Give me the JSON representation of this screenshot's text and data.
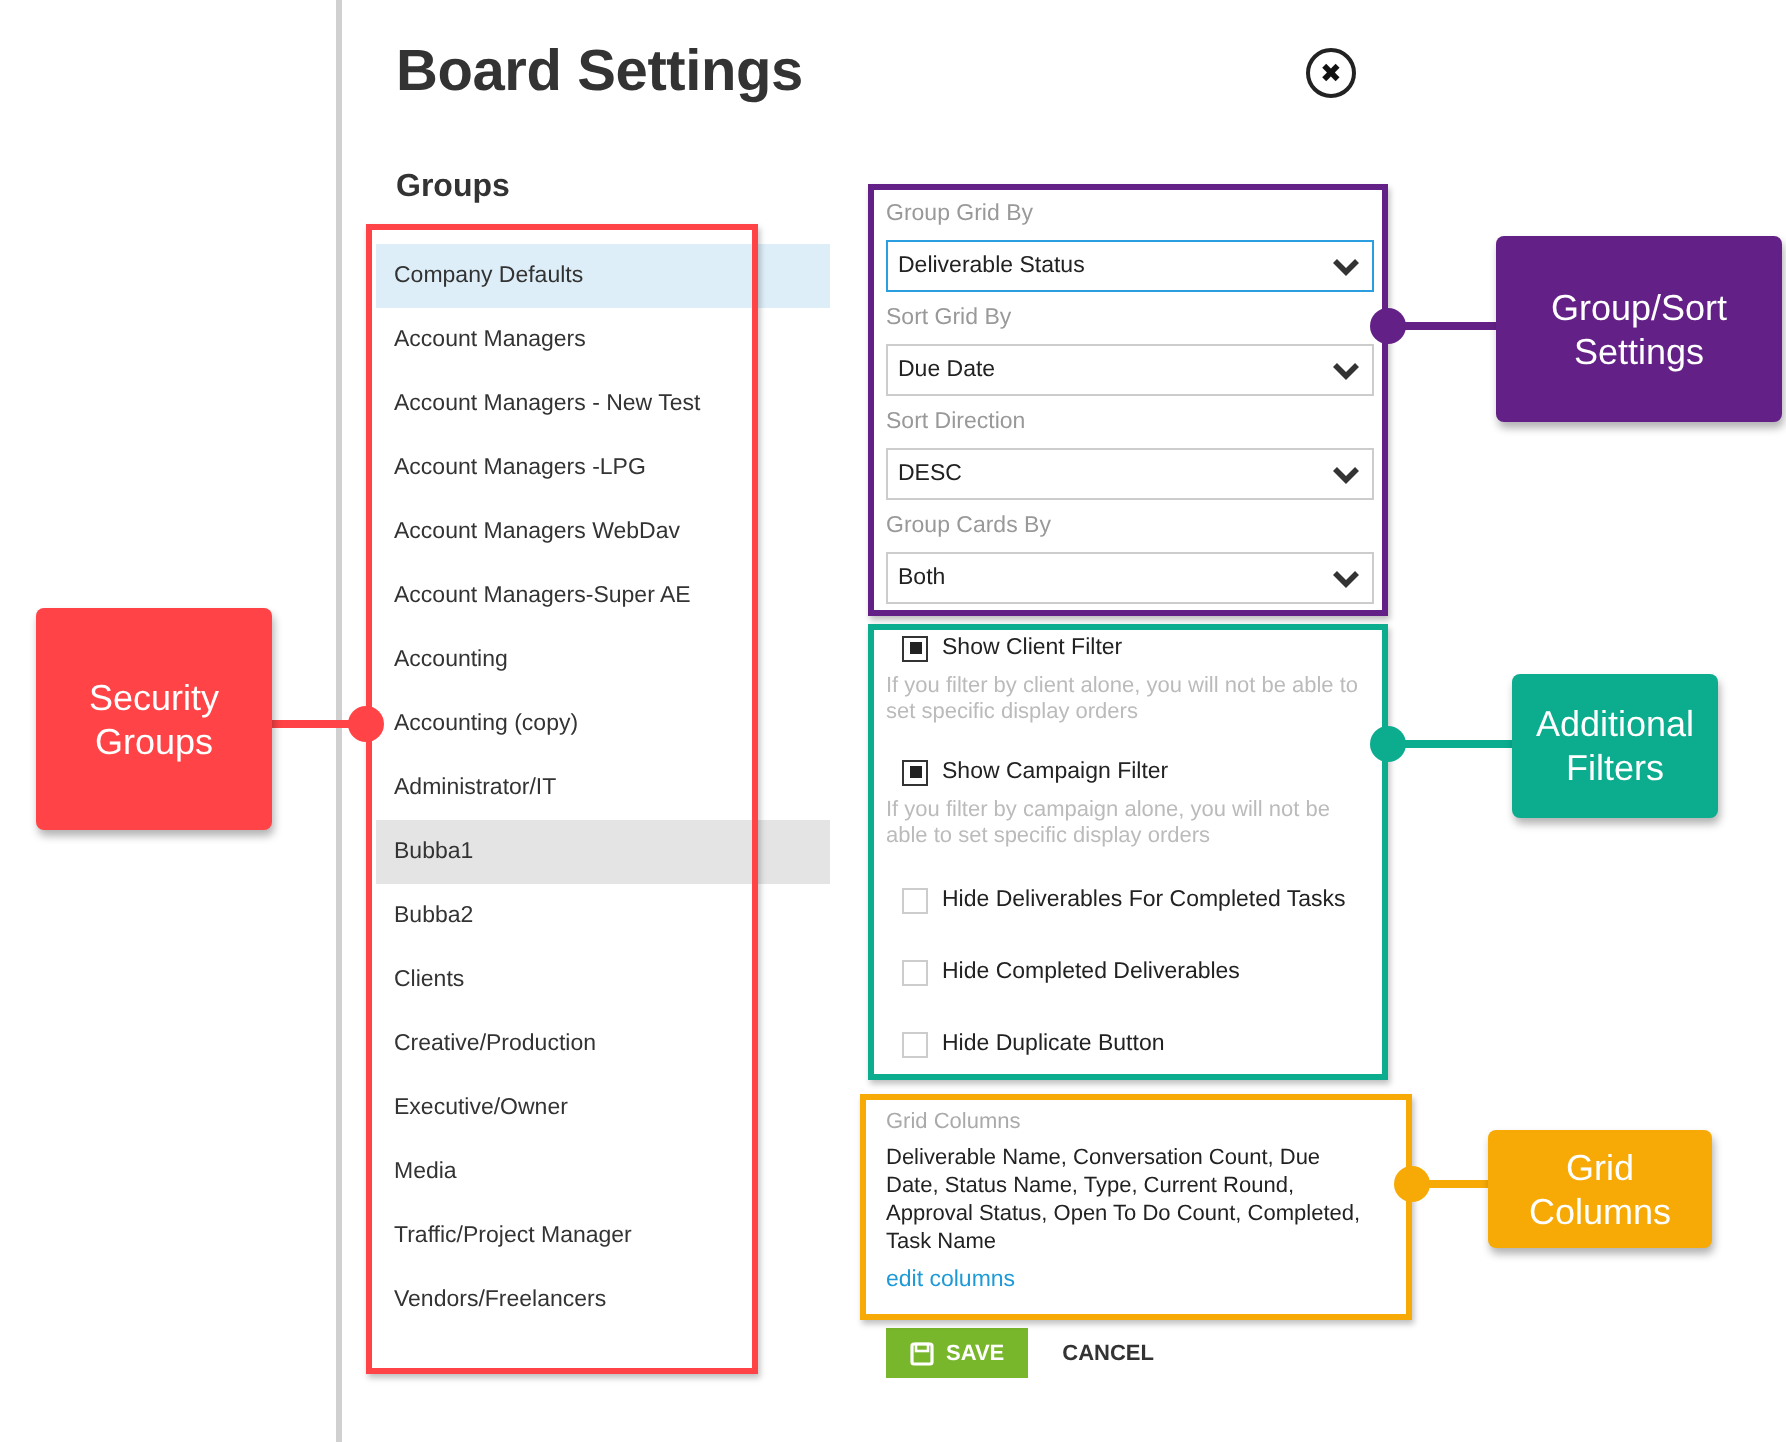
{
  "dialog": {
    "title": "Board Settings",
    "close_icon": "✖"
  },
  "groups": {
    "heading": "Groups",
    "items": [
      {
        "label": "Company Defaults",
        "selected": true,
        "hovered": false
      },
      {
        "label": "Account Managers",
        "selected": false,
        "hovered": false
      },
      {
        "label": "Account Managers - New Test",
        "selected": false,
        "hovered": false
      },
      {
        "label": "Account Managers -LPG",
        "selected": false,
        "hovered": false
      },
      {
        "label": "Account Managers WebDav",
        "selected": false,
        "hovered": false
      },
      {
        "label": "Account Managers-Super AE",
        "selected": false,
        "hovered": false
      },
      {
        "label": "Accounting",
        "selected": false,
        "hovered": false
      },
      {
        "label": "Accounting (copy)",
        "selected": false,
        "hovered": false
      },
      {
        "label": "Administrator/IT",
        "selected": false,
        "hovered": false
      },
      {
        "label": "Bubba1",
        "selected": false,
        "hovered": true
      },
      {
        "label": "Bubba2",
        "selected": false,
        "hovered": false
      },
      {
        "label": "Clients",
        "selected": false,
        "hovered": false
      },
      {
        "label": "Creative/Production",
        "selected": false,
        "hovered": false
      },
      {
        "label": "Executive/Owner",
        "selected": false,
        "hovered": false
      },
      {
        "label": "Media",
        "selected": false,
        "hovered": false
      },
      {
        "label": "Traffic/Project Manager",
        "selected": false,
        "hovered": false
      },
      {
        "label": "Vendors/Freelancers",
        "selected": false,
        "hovered": false
      }
    ]
  },
  "settings": {
    "selects": [
      {
        "label": "Group Grid By",
        "value": "Deliverable Status",
        "focused": true
      },
      {
        "label": "Sort Grid By",
        "value": "Due Date",
        "focused": false
      },
      {
        "label": "Sort Direction",
        "value": "DESC",
        "focused": false
      },
      {
        "label": "Group Cards By",
        "value": "Both",
        "focused": false
      }
    ],
    "filters": [
      {
        "label": "Show Client Filter",
        "checked": true,
        "note": "If you filter by client alone, you will not be able to set specific display orders"
      },
      {
        "label": "Show Campaign Filter",
        "checked": true,
        "note": "If you filter by campaign alone, you will not be able to set specific display orders"
      },
      {
        "label": "Hide Deliverables For Completed Tasks",
        "checked": false
      },
      {
        "label": "Hide Completed Deliverables",
        "checked": false
      },
      {
        "label": "Hide Duplicate Button",
        "checked": false
      }
    ],
    "grid_columns": {
      "label": "Grid Columns",
      "value": "Deliverable Name, Conversation Count, Due Date, Status Name, Type, Current Round, Approval Status, Open To Do Count, Completed, Task Name",
      "link": "edit columns"
    }
  },
  "buttons": {
    "save": "SAVE",
    "cancel": "CANCEL"
  },
  "annotations": [
    {
      "label": "Security Groups",
      "color": "#ff4346"
    },
    {
      "label": "Group/Sort Settings",
      "color": "#632086"
    },
    {
      "label": "Additional Filters",
      "color": "#0bad8e"
    },
    {
      "label": "Grid Columns",
      "color": "#f7aa06"
    }
  ]
}
